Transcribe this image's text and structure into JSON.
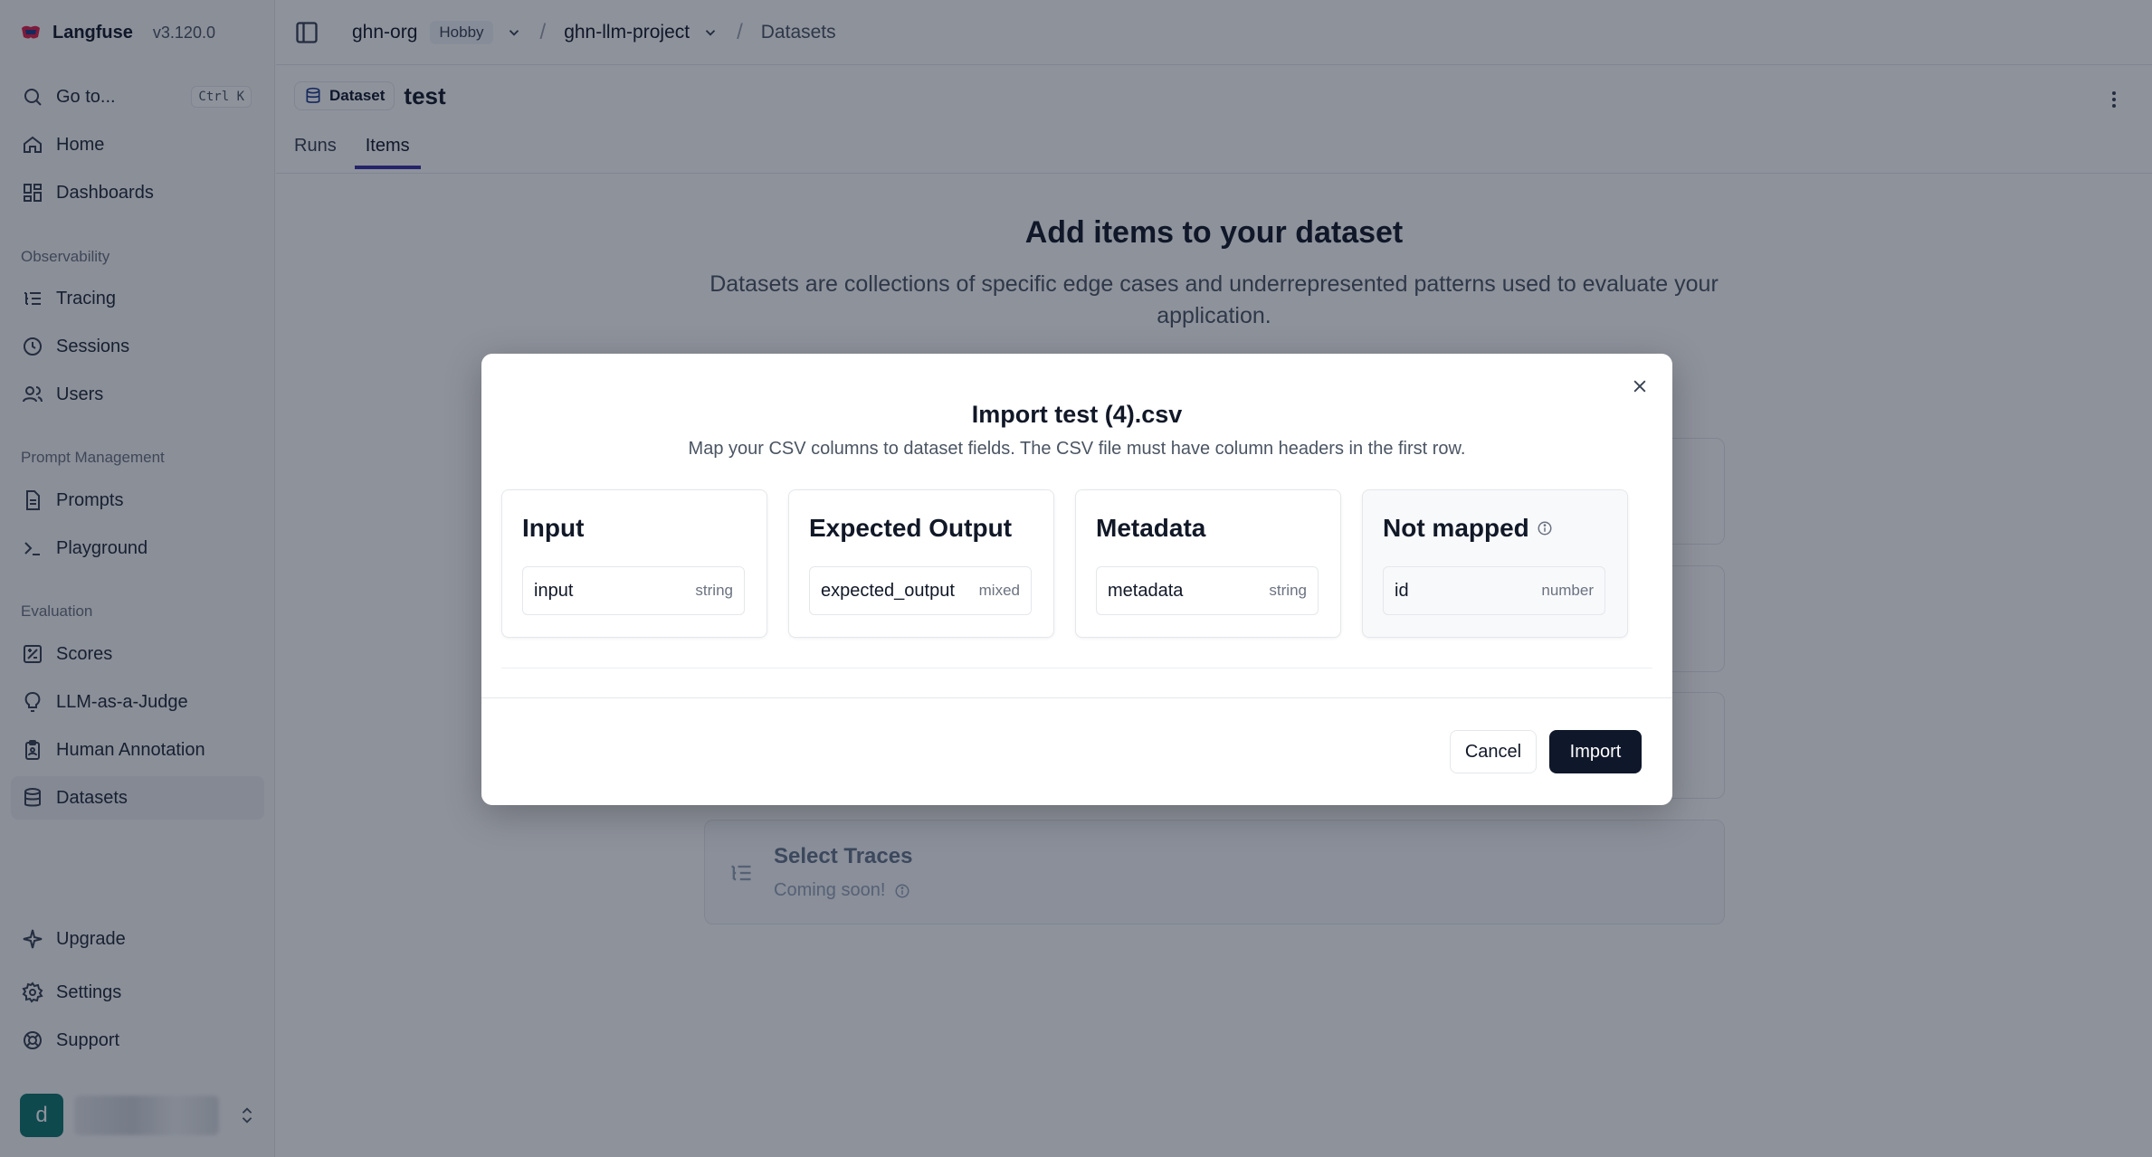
{
  "app": {
    "name": "Langfuse",
    "version": "v3.120.0"
  },
  "sidebar": {
    "goto": {
      "label": "Go to...",
      "shortcut": "Ctrl K"
    },
    "top_items": [
      {
        "label": "Home",
        "icon": "home-icon"
      },
      {
        "label": "Dashboards",
        "icon": "dashboards-icon"
      }
    ],
    "groups": [
      {
        "title": "Observability",
        "items": [
          {
            "label": "Tracing",
            "icon": "tracing-icon"
          },
          {
            "label": "Sessions",
            "icon": "clock-icon"
          },
          {
            "label": "Users",
            "icon": "users-icon"
          }
        ]
      },
      {
        "title": "Prompt Management",
        "items": [
          {
            "label": "Prompts",
            "icon": "file-icon"
          },
          {
            "label": "Playground",
            "icon": "terminal-icon"
          }
        ]
      },
      {
        "title": "Evaluation",
        "items": [
          {
            "label": "Scores",
            "icon": "scores-icon"
          },
          {
            "label": "LLM-as-a-Judge",
            "icon": "lightbulb-icon"
          },
          {
            "label": "Human Annotation",
            "icon": "annotation-icon"
          },
          {
            "label": "Datasets",
            "icon": "database-icon",
            "active": true
          }
        ]
      }
    ],
    "bottom_items": [
      {
        "label": "Upgrade",
        "icon": "sparkle-icon"
      },
      {
        "label": "Settings",
        "icon": "gear-icon"
      },
      {
        "label": "Support",
        "icon": "lifebuoy-icon"
      }
    ],
    "user": {
      "avatar_letter": "d"
    }
  },
  "breadcrumbs": {
    "org": "ghn-org",
    "plan": "Hobby",
    "project": "ghn-llm-project",
    "section": "Datasets"
  },
  "page": {
    "badge": "Dataset",
    "dataset_name": "test",
    "tabs": [
      {
        "label": "Runs"
      },
      {
        "label": "Items",
        "active": true
      }
    ],
    "empty_title": "Add items to your dataset",
    "empty_description": "Datasets are collections of specific edge cases and underrepresented patterns used to evaluate your application.",
    "options": [
      {
        "title": "Select Traces",
        "subtitle": "Coming soon!"
      }
    ]
  },
  "dialog": {
    "title": "Import test (4).csv",
    "subtitle": "Map your CSV columns to dataset fields. The CSV file must have column headers in the first row.",
    "columns": [
      {
        "title": "Input",
        "field": "input",
        "type": "string"
      },
      {
        "title": "Expected Output",
        "field": "expected_output",
        "type": "mixed"
      },
      {
        "title": "Metadata",
        "field": "metadata",
        "type": "string"
      },
      {
        "title": "Not mapped",
        "field": "id",
        "type": "number"
      }
    ],
    "cancel_label": "Cancel",
    "import_label": "Import"
  }
}
